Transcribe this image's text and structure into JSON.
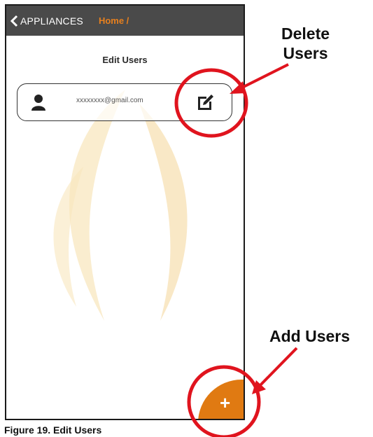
{
  "topbar": {
    "back_label": "APPLIANCES",
    "breadcrumb": "Home /"
  },
  "screen": {
    "title": "Edit Users",
    "users": [
      {
        "email": "xxxxxxxx@gmail.com"
      }
    ]
  },
  "fab": {
    "symbol": "+"
  },
  "annotations": {
    "delete": "Delete\nUsers",
    "add": "Add Users"
  },
  "caption": "Figure 19. Edit Users",
  "colors": {
    "topbar": "#4a4a4a",
    "accent": "#e8801e",
    "annotation_red": "#e0141e"
  },
  "icons": [
    "chevron-left-icon",
    "person-icon",
    "edit-icon",
    "plus-icon"
  ]
}
